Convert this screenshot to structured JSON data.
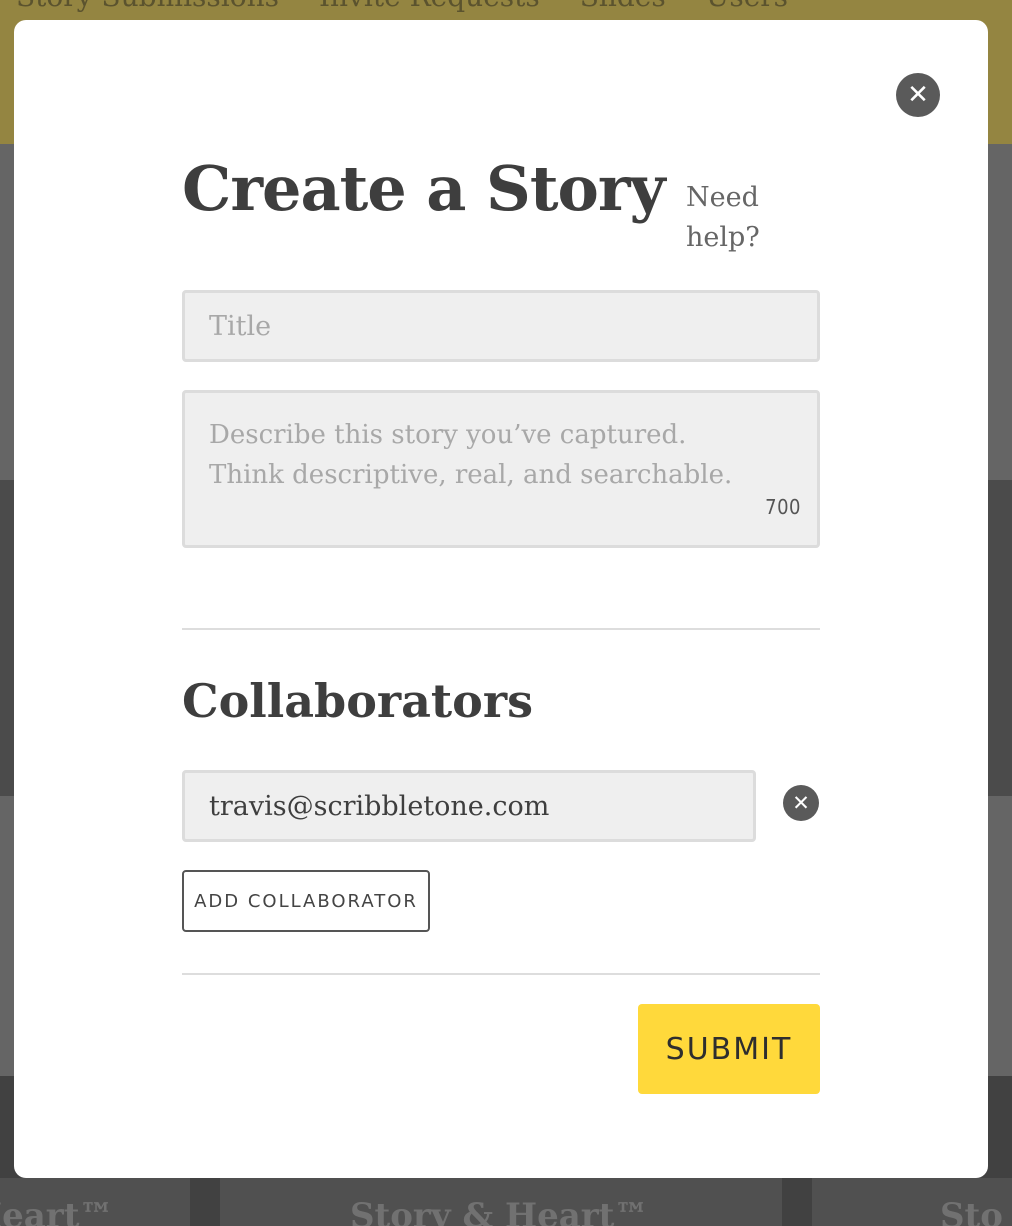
{
  "background": {
    "nav_items": [
      "Story Submissions",
      "Invite Requests",
      "Slides",
      "Users"
    ],
    "card_titles": [
      "Heart™",
      "Story & Heart™",
      "Sto"
    ]
  },
  "modal": {
    "title": "Create a Story",
    "help_link": "Need help?",
    "title_field": {
      "placeholder": "Title",
      "value": ""
    },
    "description_field": {
      "placeholder_lines": [
        "Describe this story you’ve captured.",
        "Think descriptive, real, and searchable."
      ],
      "char_remaining": "700"
    },
    "collaborators": {
      "heading": "Collaborators",
      "items": [
        {
          "email": "travis@scribbletone.com"
        }
      ],
      "add_label": "ADD COLLABORATOR"
    },
    "submit_label": "SUBMIT",
    "colors": {
      "accent": "#ffd93b",
      "topbar": "#b9a44a",
      "text_dark": "#3e3e3e",
      "field_bg": "#efefef"
    },
    "icons": {
      "close": "close-circle-icon",
      "remove": "remove-circle-icon"
    }
  }
}
